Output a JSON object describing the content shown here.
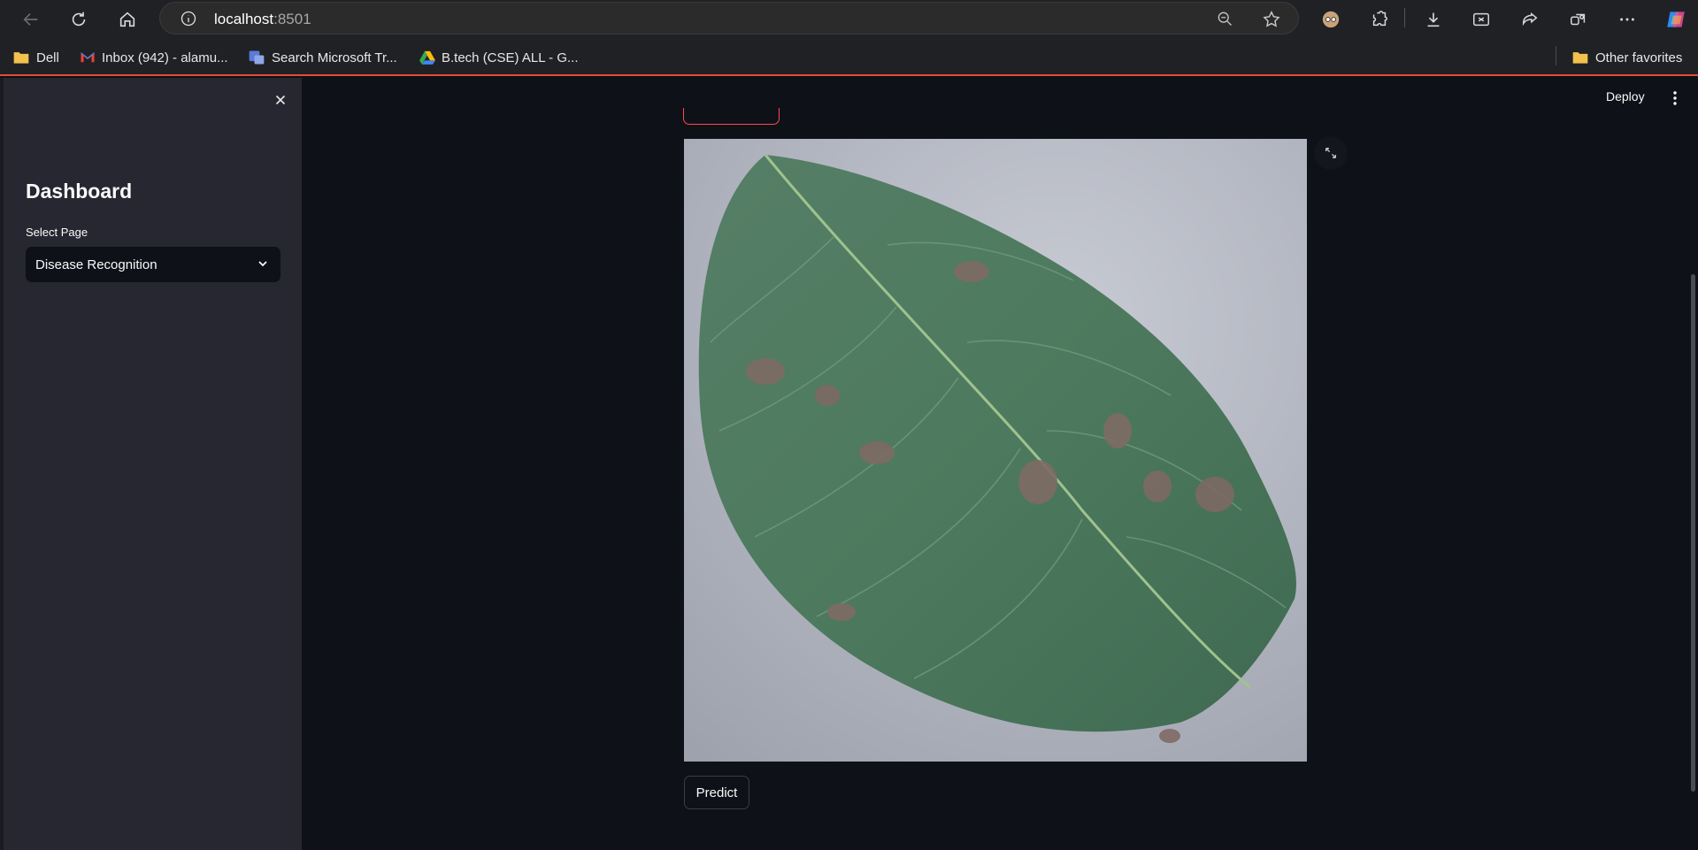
{
  "browser": {
    "url_host": "localhost",
    "url_port": ":8501",
    "bookmarks": [
      {
        "label": "Dell",
        "icon": "folder-icon"
      },
      {
        "label": "Inbox (942) - alamu...",
        "icon": "gmail-icon"
      },
      {
        "label": "Search Microsoft Tr...",
        "icon": "translator-icon"
      },
      {
        "label": "B.tech (CSE) ALL - G...",
        "icon": "google-drive-icon"
      }
    ],
    "other_favorites": "Other favorites"
  },
  "sidebar": {
    "title": "Dashboard",
    "select_label": "Select Page",
    "select_value": "Disease Recognition"
  },
  "header": {
    "deploy_label": "Deploy"
  },
  "main": {
    "predict_label": "Predict"
  },
  "colors": {
    "background": "#0e1117",
    "sidebar": "#262730",
    "accent": "#ff4b4b",
    "leaf": "#4d7a5e"
  }
}
